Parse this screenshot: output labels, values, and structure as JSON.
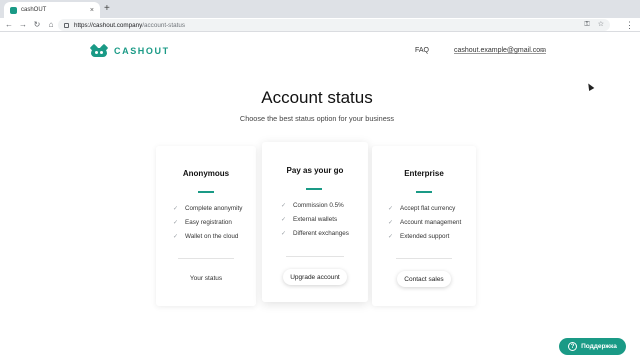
{
  "browser": {
    "tab_title": "cashOUT",
    "tab_close": "×",
    "new_tab": "+",
    "nav": {
      "back": "←",
      "forward": "→",
      "reload": "↻",
      "home": "⌂"
    },
    "url_host": "https://cashout.company",
    "url_path": "/account-status",
    "omni_icons": [
      "key-icon",
      "star-icon"
    ],
    "omni_glyphs": {
      "key": "⚿",
      "star": "☆"
    },
    "menu": "⋮"
  },
  "header": {
    "logo_text": "CASHOUT",
    "faq_label": "FAQ",
    "user_email": "cashout.example@gmail.com",
    "chevron": "⌄"
  },
  "hero": {
    "title": "Account status",
    "subtitle": "Choose the best status option for your business"
  },
  "plans": [
    {
      "name": "Anonymous",
      "features": [
        "Complete anonymity",
        "Easy registration",
        "Wallet on the cloud"
      ],
      "action": "Your status"
    },
    {
      "name": "Pay as your go",
      "features": [
        "Commission 0.5%",
        "External wallets",
        "Different exchanges"
      ],
      "action": "Upgrade account"
    },
    {
      "name": "Enterprise",
      "features": [
        "Accept flat currency",
        "Account management",
        "Extended support"
      ],
      "action": "Contact sales"
    }
  ],
  "check_glyph": "✓",
  "support": {
    "label": "Поддержка",
    "icon_glyph": "?"
  },
  "colors": {
    "accent": "#1a9a86",
    "text": "#222222",
    "muted": "#9aa0a6"
  }
}
